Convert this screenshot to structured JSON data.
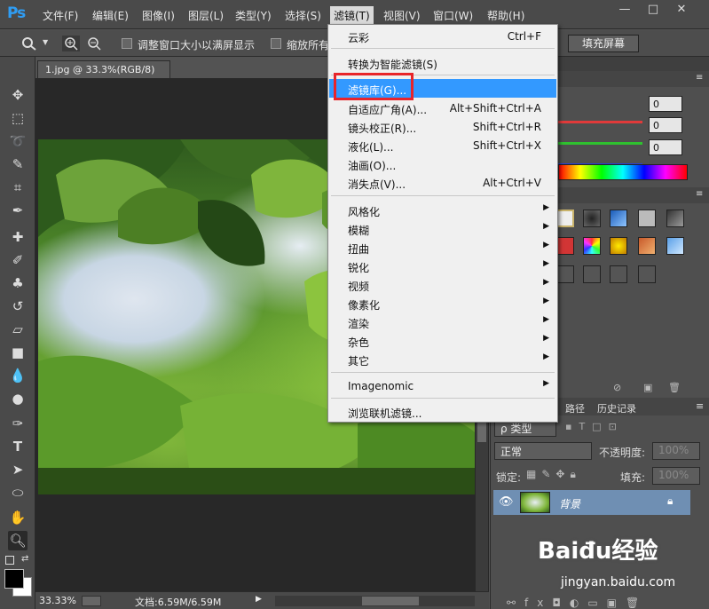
{
  "app": {
    "logo": "Ps"
  },
  "menubar": {
    "items": [
      "文件(F)",
      "编辑(E)",
      "图像(I)",
      "图层(L)",
      "类型(Y)",
      "选择(S)",
      "滤镜(T)",
      "视图(V)",
      "窗口(W)",
      "帮助(H)"
    ],
    "active": "滤镜(T)",
    "window_buttons": [
      "—",
      "□",
      "✕"
    ]
  },
  "options": {
    "resize_windows_label": "调整窗口大小以满屏显示",
    "zoom_all_label": "缩放所有",
    "fill_screen_label": "填充屏幕"
  },
  "document": {
    "tab_title": "1.jpg @ 33.3%(RGB/8)",
    "tab_close": "×",
    "zoom": "33.33%",
    "doc_size": "文档:6.59M/6.59M"
  },
  "filter_menu": {
    "items": [
      {
        "label": "云彩",
        "shortcut": "Ctrl+F"
      },
      {
        "label": "转换为智能滤镜(S)",
        "shortcut": ""
      },
      {
        "label": "滤镜库(G)...",
        "shortcut": "",
        "highlighted": true
      },
      {
        "label": "自适应广角(A)...",
        "shortcut": "Alt+Shift+Ctrl+A"
      },
      {
        "label": "镜头校正(R)...",
        "shortcut": "Shift+Ctrl+R"
      },
      {
        "label": "液化(L)...",
        "shortcut": "Shift+Ctrl+X"
      },
      {
        "label": "油画(O)...",
        "shortcut": ""
      },
      {
        "label": "消失点(V)...",
        "shortcut": "Alt+Ctrl+V"
      },
      {
        "label": "风格化",
        "submenu": true
      },
      {
        "label": "模糊",
        "submenu": true
      },
      {
        "label": "扭曲",
        "submenu": true
      },
      {
        "label": "锐化",
        "submenu": true
      },
      {
        "label": "视频",
        "submenu": true
      },
      {
        "label": "像素化",
        "submenu": true
      },
      {
        "label": "渲染",
        "submenu": true
      },
      {
        "label": "杂色",
        "submenu": true
      },
      {
        "label": "其它",
        "submenu": true
      },
      {
        "label": "Imagenomic",
        "submenu": true
      },
      {
        "label": "浏览联机滤镜..."
      }
    ],
    "submenu_arrow": "▶"
  },
  "color_panel": {
    "r": "0",
    "g": "0",
    "b": "0"
  },
  "layers_panel": {
    "tabs": [
      "路径",
      "历史记录"
    ],
    "filter_kind": "ρ 类型",
    "blend_mode": "正常",
    "opacity_label": "不透明度:",
    "opacity_value": "100%",
    "lock_label": "锁定:",
    "fill_label": "填充:",
    "fill_value": "100%",
    "layer_name": "背景"
  },
  "watermark": {
    "brand": "Baiđu经验",
    "url": "jingyan.baidu.com"
  },
  "colors": {
    "accent": "#3399ff",
    "highlight_box": "#e8252a",
    "layer_selected": "#6f8fb3"
  }
}
